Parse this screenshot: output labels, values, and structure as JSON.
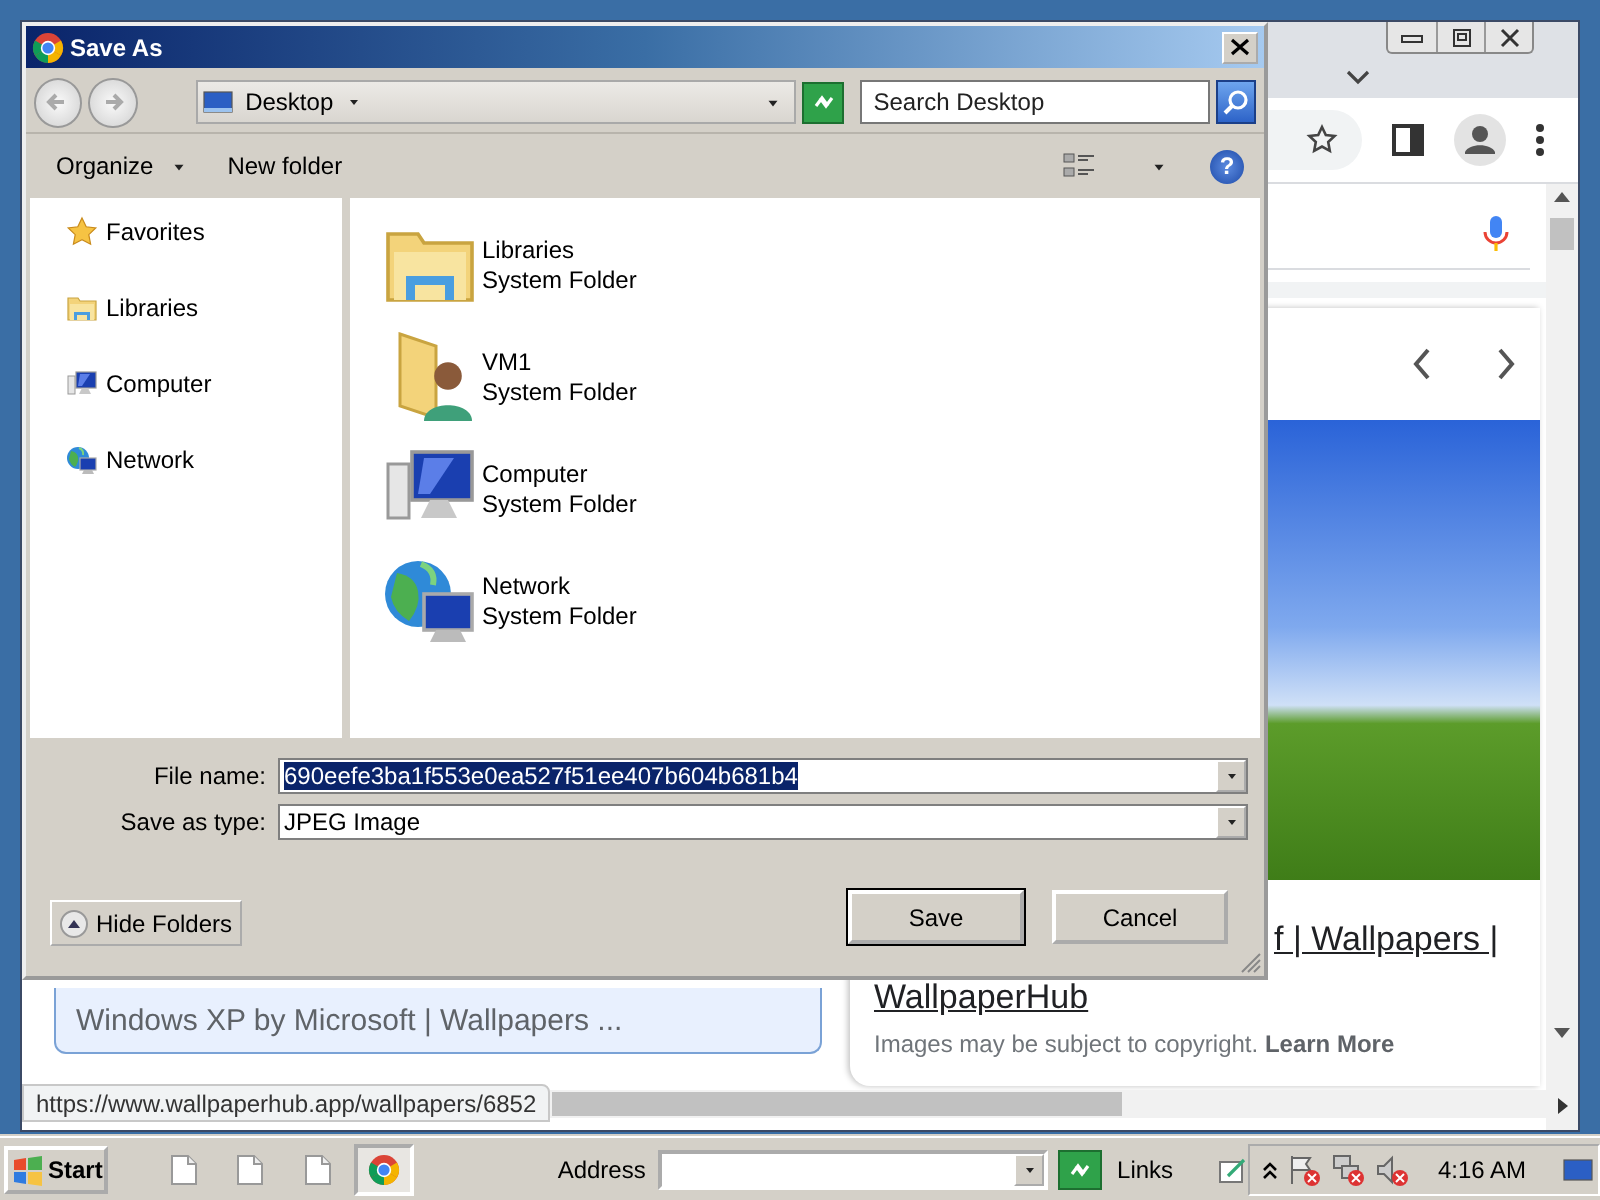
{
  "browser": {
    "image_result": {
      "title": "f | Wallpapers |",
      "source": "WallpaperHub",
      "notice": "Images may be subject to copyright.",
      "notice_link": "Learn More"
    },
    "result_card": {
      "title": "Windows XP by Microsoft | Wallpapers ..."
    },
    "status_url": "https://www.wallpaperhub.app/wallpapers/6852"
  },
  "dialog": {
    "title": "Save As",
    "location": "Desktop",
    "search": {
      "placeholder": "Search Desktop"
    },
    "toolbar": {
      "organize": "Organize",
      "new_folder": "New folder",
      "help": "?"
    },
    "nav_items": [
      {
        "kind": "favorites",
        "label": "Favorites"
      },
      {
        "kind": "libraries",
        "label": "Libraries"
      },
      {
        "kind": "computer",
        "label": "Computer"
      },
      {
        "kind": "network",
        "label": "Network"
      }
    ],
    "items": [
      {
        "kind": "libraries",
        "name": "Libraries",
        "type": "System Folder"
      },
      {
        "kind": "user",
        "name": "VM1",
        "type": "System Folder"
      },
      {
        "kind": "computer",
        "name": "Computer",
        "type": "System Folder"
      },
      {
        "kind": "network",
        "name": "Network",
        "type": "System Folder"
      }
    ],
    "file_name": {
      "label": "File name:",
      "value": "690eefe3ba1f553e0ea527f51ee407b604b681b4",
      "selected": true
    },
    "save_as_type": {
      "label": "Save as type:",
      "value": "JPEG Image"
    },
    "hide_folders": "Hide Folders",
    "buttons": [
      {
        "label": "Save",
        "default": true
      },
      {
        "label": "Cancel",
        "default": false
      }
    ]
  },
  "taskbar": {
    "start": "Start",
    "tasks": [
      {
        "kind": "document",
        "selected": false
      },
      {
        "kind": "document",
        "selected": false
      },
      {
        "kind": "document",
        "selected": false
      },
      {
        "kind": "browser",
        "selected": true
      }
    ],
    "address_label": "Address",
    "links": "Links",
    "clock": "4:16 AM"
  }
}
